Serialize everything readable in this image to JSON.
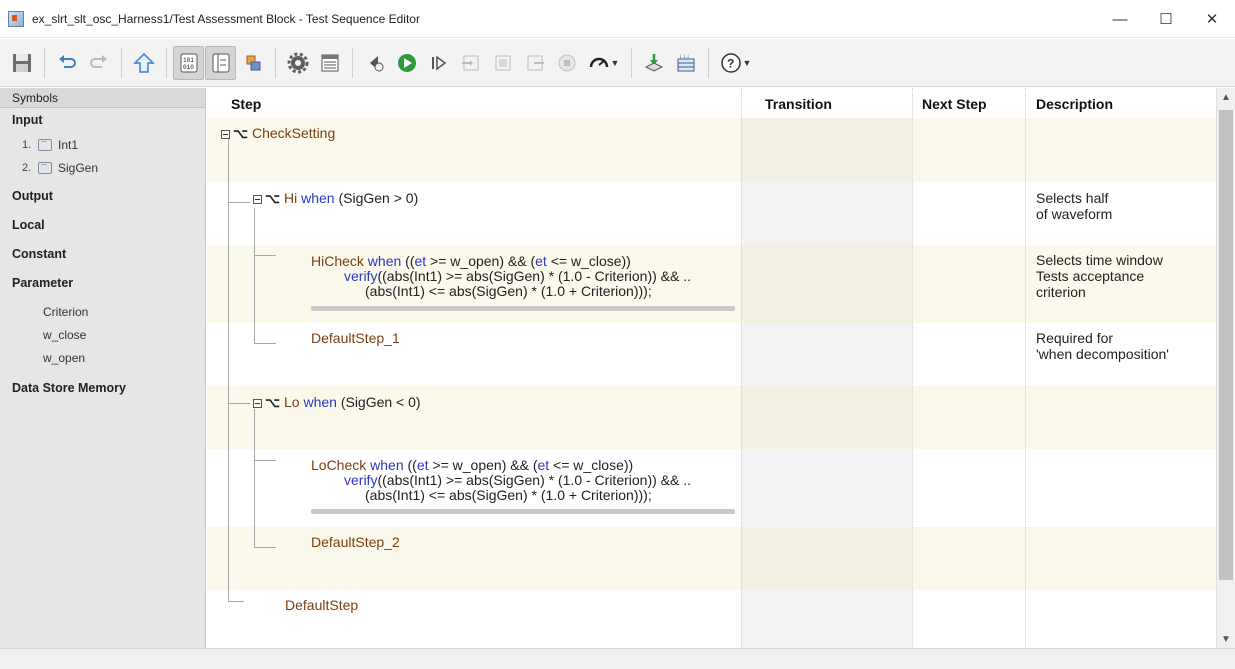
{
  "window": {
    "title": "ex_slrt_slt_osc_Harness1/Test Assessment Block - Test Sequence Editor",
    "minimize": "—",
    "maximize": "☐",
    "close": "✕"
  },
  "toolbar": {
    "buttons": [
      "save-icon",
      "undo-icon",
      "redo-icon",
      "up-icon",
      "data-symbols-icon",
      "step-pane-icon",
      "mapping-icon",
      "settings-icon",
      "properties-icon",
      "step-back-icon",
      "run-icon",
      "step-forward-icon",
      "step-in-icon",
      "step-over-icon",
      "step-out-icon",
      "stop-icon",
      "speed-icon",
      "import-icon",
      "data-table-icon",
      "help-icon"
    ],
    "active": [
      "data-symbols-icon",
      "step-pane-icon"
    ]
  },
  "symbols": {
    "header": "Symbols",
    "input_label": "Input",
    "inputs": [
      {
        "num": "1.",
        "name": "Int1"
      },
      {
        "num": "2.",
        "name": "SigGen"
      }
    ],
    "output_label": "Output",
    "local_label": "Local",
    "constant_label": "Constant",
    "parameter_label": "Parameter",
    "parameters": [
      "Criterion",
      "w_close",
      "w_open"
    ],
    "dsm_label": "Data Store Memory"
  },
  "columns": {
    "step": "Step",
    "transition": "Transition",
    "next_step": "Next Step",
    "description": "Description"
  },
  "steps": {
    "checksetting": "CheckSetting",
    "hi": {
      "name": "Hi",
      "when": "when",
      "cond": "(SigGen > 0)",
      "desc1": "Selects half",
      "desc2": "of waveform"
    },
    "hicheck": {
      "name": "HiCheck",
      "when": "when",
      "c1": "((",
      "et1": "et",
      "c2": " >= w_open) && (",
      "et2": "et",
      "c3": " <= w_close))",
      "verify": "verify",
      "v1": "((abs(Int1) >= abs(SigGen) * (1.0 - Criterion)) && ..",
      "v2": "(abs(Int1) <= abs(SigGen) * (1.0 + Criterion)));",
      "desc1": "Selects time window",
      "desc2": "Tests acceptance",
      "desc3": "criterion"
    },
    "default1": {
      "name": "DefaultStep_1",
      "desc1": "Required for",
      "desc2": "'when decomposition'"
    },
    "lo": {
      "name": "Lo",
      "when": "when",
      "cond": "(SigGen < 0)"
    },
    "locheck": {
      "name": "LoCheck",
      "when": "when",
      "c1": "((",
      "et1": "et",
      "c2": " >= w_open) && (",
      "et2": "et",
      "c3": " <= w_close))",
      "verify": "verify",
      "v1": "((abs(Int1) >= abs(SigGen) * (1.0 - Criterion)) && ..",
      "v2": "(abs(Int1) <= abs(SigGen) * (1.0 + Criterion)));"
    },
    "default2": {
      "name": "DefaultStep_2"
    },
    "default": {
      "name": "DefaultStep"
    }
  }
}
